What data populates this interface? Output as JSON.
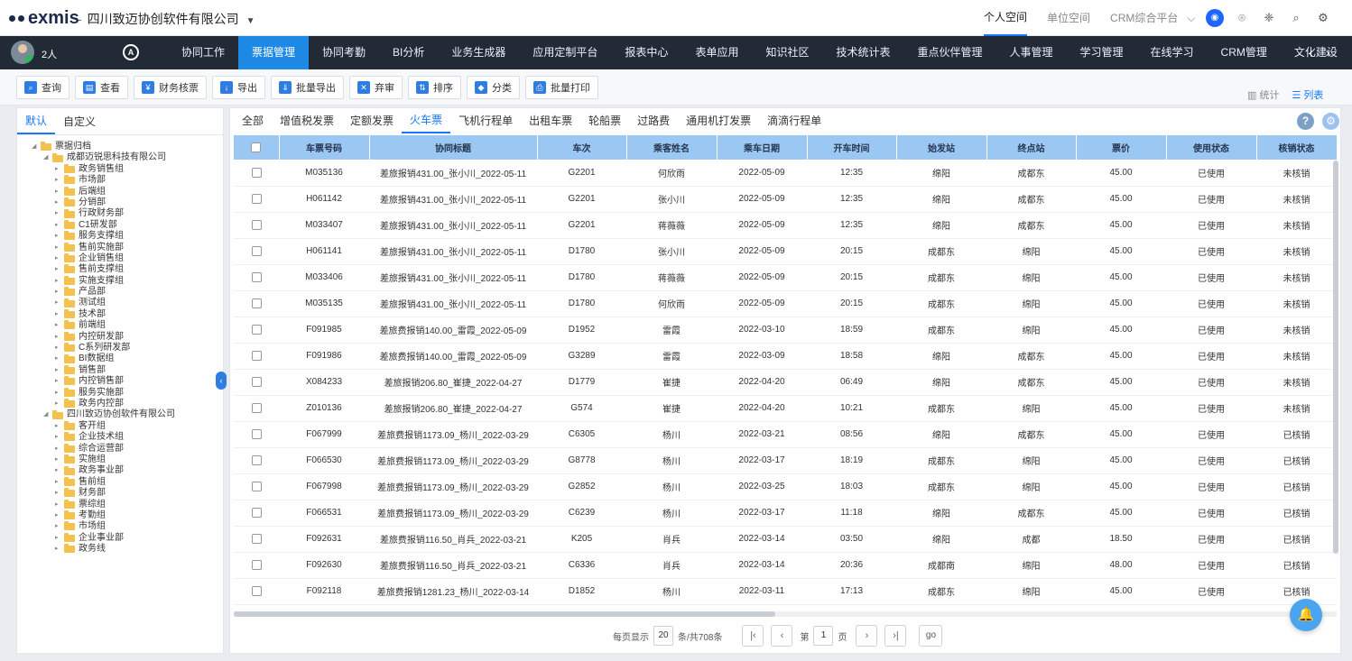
{
  "app": {
    "logo_letters": "exmis",
    "company": "四川致迈协创软件有限公司"
  },
  "top_links": [
    "个人空间",
    "单位空间",
    "CRM综合平台"
  ],
  "user": {
    "count": "2人"
  },
  "nav": {
    "items": [
      "协同工作",
      "票据管理",
      "协同考勤",
      "BI分析",
      "业务生成器",
      "应用定制平台",
      "报表中心",
      "表单应用",
      "知识社区",
      "技术统计表",
      "重点伙伴管理",
      "人事管理",
      "学习管理",
      "在线学习",
      "CRM管理",
      "文化建设"
    ],
    "active_index": 1
  },
  "toolbar": {
    "buttons": [
      "查询",
      "查看",
      "财务核票",
      "导出",
      "批量导出",
      "弃审",
      "排序",
      "分类",
      "批量打印"
    ],
    "view_stats": "统计",
    "view_list": "列表"
  },
  "left": {
    "tabs": [
      "默认",
      "自定义"
    ],
    "tree": [
      {
        "level": 0,
        "label": "票据归档"
      },
      {
        "level": 1,
        "label": "成都迈锐思科技有限公司"
      },
      {
        "level": 2,
        "label": "政务销售组"
      },
      {
        "level": 2,
        "label": "市场部"
      },
      {
        "level": 2,
        "label": "后端组"
      },
      {
        "level": 2,
        "label": "分销部"
      },
      {
        "level": 2,
        "label": "行政财务部"
      },
      {
        "level": 2,
        "label": "C1研发部"
      },
      {
        "level": 2,
        "label": "服务支撑组"
      },
      {
        "level": 2,
        "label": "售前实施部"
      },
      {
        "level": 2,
        "label": "企业销售组"
      },
      {
        "level": 2,
        "label": "售前支撑组"
      },
      {
        "level": 2,
        "label": "实施支撑组"
      },
      {
        "level": 2,
        "label": "产品部"
      },
      {
        "level": 2,
        "label": "测试组"
      },
      {
        "level": 2,
        "label": "技术部"
      },
      {
        "level": 2,
        "label": "前端组"
      },
      {
        "level": 2,
        "label": "内控研发部"
      },
      {
        "level": 2,
        "label": "C系列研发部"
      },
      {
        "level": 2,
        "label": "BI数据组"
      },
      {
        "level": 2,
        "label": "销售部"
      },
      {
        "level": 2,
        "label": "内控销售部"
      },
      {
        "level": 2,
        "label": "服务实施部"
      },
      {
        "level": 2,
        "label": "政务内控部"
      },
      {
        "level": 1,
        "label": "四川致迈协创软件有限公司"
      },
      {
        "level": 2,
        "label": "客开组"
      },
      {
        "level": 2,
        "label": "企业技术组"
      },
      {
        "level": 2,
        "label": "综合运营部"
      },
      {
        "level": 2,
        "label": "实施组"
      },
      {
        "level": 2,
        "label": "政务事业部"
      },
      {
        "level": 2,
        "label": "售前组"
      },
      {
        "level": 2,
        "label": "财务部"
      },
      {
        "level": 2,
        "label": "票综组"
      },
      {
        "level": 2,
        "label": "考勤组"
      },
      {
        "level": 2,
        "label": "市场组"
      },
      {
        "level": 2,
        "label": "企业事业部"
      },
      {
        "level": 2,
        "label": "政务线"
      }
    ]
  },
  "categories": {
    "tabs": [
      "全部",
      "增值税发票",
      "定额发票",
      "火车票",
      "飞机行程单",
      "出租车票",
      "轮船票",
      "过路费",
      "通用机打发票",
      "滴滴行程单"
    ],
    "active_index": 3
  },
  "table": {
    "columns": [
      "车票号码",
      "协同标题",
      "车次",
      "乘客姓名",
      "乘车日期",
      "开车时间",
      "始发站",
      "终点站",
      "票价",
      "使用状态",
      "核销状态"
    ],
    "rows": [
      [
        "M035136",
        "差旅报销431.00_张小川_2022-05-11",
        "G2201",
        "何欣雨",
        "2022-05-09",
        "12:35",
        "绵阳",
        "成都东",
        "45.00",
        "已使用",
        "未核销"
      ],
      [
        "H061142",
        "差旅报销431.00_张小川_2022-05-11",
        "G2201",
        "张小川",
        "2022-05-09",
        "12:35",
        "绵阳",
        "成都东",
        "45.00",
        "已使用",
        "未核销"
      ],
      [
        "M033407",
        "差旅报销431.00_张小川_2022-05-11",
        "G2201",
        "蒋薇薇",
        "2022-05-09",
        "12:35",
        "绵阳",
        "成都东",
        "45.00",
        "已使用",
        "未核销"
      ],
      [
        "H061141",
        "差旅报销431.00_张小川_2022-05-11",
        "D1780",
        "张小川",
        "2022-05-09",
        "20:15",
        "成都东",
        "绵阳",
        "45.00",
        "已使用",
        "未核销"
      ],
      [
        "M033406",
        "差旅报销431.00_张小川_2022-05-11",
        "D1780",
        "蒋薇薇",
        "2022-05-09",
        "20:15",
        "成都东",
        "绵阳",
        "45.00",
        "已使用",
        "未核销"
      ],
      [
        "M035135",
        "差旅报销431.00_张小川_2022-05-11",
        "D1780",
        "何欣雨",
        "2022-05-09",
        "20:15",
        "成都东",
        "绵阳",
        "45.00",
        "已使用",
        "未核销"
      ],
      [
        "F091985",
        "差旅费报销140.00_雷霞_2022-05-09",
        "D1952",
        "雷霞",
        "2022-03-10",
        "18:59",
        "成都东",
        "绵阳",
        "45.00",
        "已使用",
        "未核销"
      ],
      [
        "F091986",
        "差旅费报销140.00_雷霞_2022-05-09",
        "G3289",
        "雷霞",
        "2022-03-09",
        "18:58",
        "绵阳",
        "成都东",
        "45.00",
        "已使用",
        "未核销"
      ],
      [
        "X084233",
        "差旅报销206.80_崔捷_2022-04-27",
        "D1779",
        "崔捷",
        "2022-04-20",
        "06:49",
        "绵阳",
        "成都东",
        "45.00",
        "已使用",
        "未核销"
      ],
      [
        "Z010136",
        "差旅报销206.80_崔捷_2022-04-27",
        "G574",
        "崔捷",
        "2022-04-20",
        "10:21",
        "成都东",
        "绵阳",
        "45.00",
        "已使用",
        "未核销"
      ],
      [
        "F067999",
        "差旅费报销1173.09_杨川_2022-03-29",
        "C6305",
        "杨川",
        "2022-03-21",
        "08:56",
        "绵阳",
        "成都东",
        "45.00",
        "已使用",
        "已核销"
      ],
      [
        "F066530",
        "差旅费报销1173.09_杨川_2022-03-29",
        "G8778",
        "杨川",
        "2022-03-17",
        "18:19",
        "成都东",
        "绵阳",
        "45.00",
        "已使用",
        "已核销"
      ],
      [
        "F067998",
        "差旅费报销1173.09_杨川_2022-03-29",
        "G2852",
        "杨川",
        "2022-03-25",
        "18:03",
        "成都东",
        "绵阳",
        "45.00",
        "已使用",
        "已核销"
      ],
      [
        "F066531",
        "差旅费报销1173.09_杨川_2022-03-29",
        "C6239",
        "杨川",
        "2022-03-17",
        "11:18",
        "绵阳",
        "成都东",
        "45.00",
        "已使用",
        "已核销"
      ],
      [
        "F092631",
        "差旅费报销116.50_肖兵_2022-03-21",
        "K205",
        "肖兵",
        "2022-03-14",
        "03:50",
        "绵阳",
        "成都",
        "18.50",
        "已使用",
        "已核销"
      ],
      [
        "F092630",
        "差旅费报销116.50_肖兵_2022-03-21",
        "C6336",
        "肖兵",
        "2022-03-14",
        "20:36",
        "成都南",
        "绵阳",
        "48.00",
        "已使用",
        "已核销"
      ],
      [
        "F092118",
        "差旅费报销1281.23_杨川_2022-03-14",
        "D1852",
        "杨川",
        "2022-03-11",
        "17:13",
        "成都东",
        "绵阳",
        "45.00",
        "已使用",
        "已核销"
      ]
    ]
  },
  "pager": {
    "per_page_label": "每页显示",
    "per_page": "20",
    "total_label": "条/共708条",
    "page_prefix": "第",
    "page": "1",
    "page_suffix": "页",
    "go": "go"
  },
  "colors": {
    "accent": "#1e88e5",
    "nav_bg": "#222a35",
    "header_bg": "#9bc8f2"
  }
}
